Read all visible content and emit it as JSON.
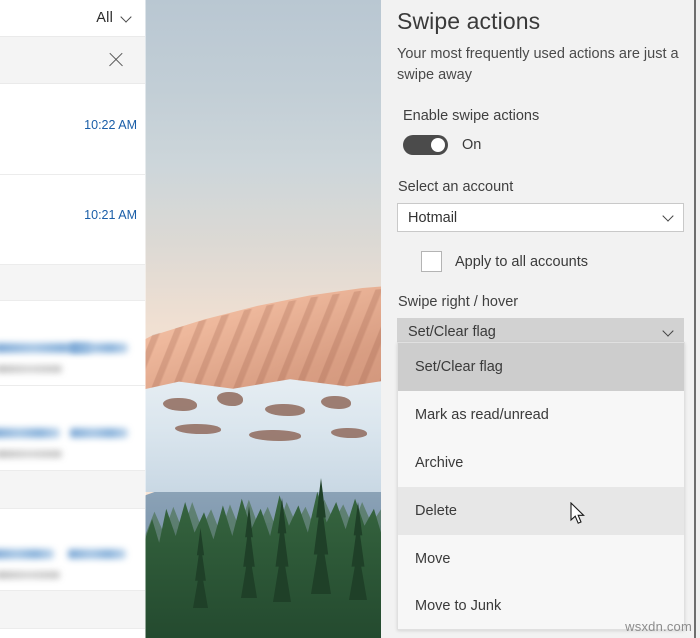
{
  "mail_list": {
    "filter_label": "All",
    "filter_chevron_icon": "chevron-down-icon",
    "close_icon": "close-icon",
    "rows": [
      {
        "time": "10:22 AM"
      },
      {
        "time": "10:21 AM"
      }
    ],
    "redacted_rows": [
      {
        "note": "blurred-sender-and-subject"
      },
      {
        "note": "blurred-sender-and-subject"
      },
      {
        "note": "blurred-sender-and-subject"
      }
    ]
  },
  "photo": {
    "alt": "mountain-sunrise-photo",
    "sky_top_color": "#b9c7d2",
    "sky_bottom_color": "#f8e6d7",
    "peak_color": "#f0bda2",
    "snow_color": "#dbe6ee",
    "forest_color": "#2f5b39"
  },
  "settings": {
    "title": "Swipe actions",
    "subtitle": "Your most frequently used actions are just a swipe away",
    "enable_label": "Enable swipe actions",
    "toggle_state": "On",
    "account_label": "Select an account",
    "account_value": "Hotmail",
    "account_chevron_icon": "chevron-down-icon",
    "apply_all_label": "Apply to all accounts",
    "apply_all_checked": false,
    "swipe_right_label": "Swipe right / hover",
    "swipe_right_value": "Set/Clear flag",
    "swipe_right_chevron_icon": "chevron-down-icon",
    "dropdown_options": [
      {
        "label": "Set/Clear flag",
        "state": "selected"
      },
      {
        "label": "Mark as read/unread",
        "state": "normal"
      },
      {
        "label": "Archive",
        "state": "normal"
      },
      {
        "label": "Delete",
        "state": "hover"
      },
      {
        "label": "Move",
        "state": "normal"
      },
      {
        "label": "Move to Junk",
        "state": "normal"
      }
    ],
    "accent_selected_color": "#cdcdcd",
    "accent_hover_color": "#e7e7e7"
  },
  "overlay": {
    "cursor_icon": "arrow-cursor",
    "watermark": "wsxdn.com"
  }
}
